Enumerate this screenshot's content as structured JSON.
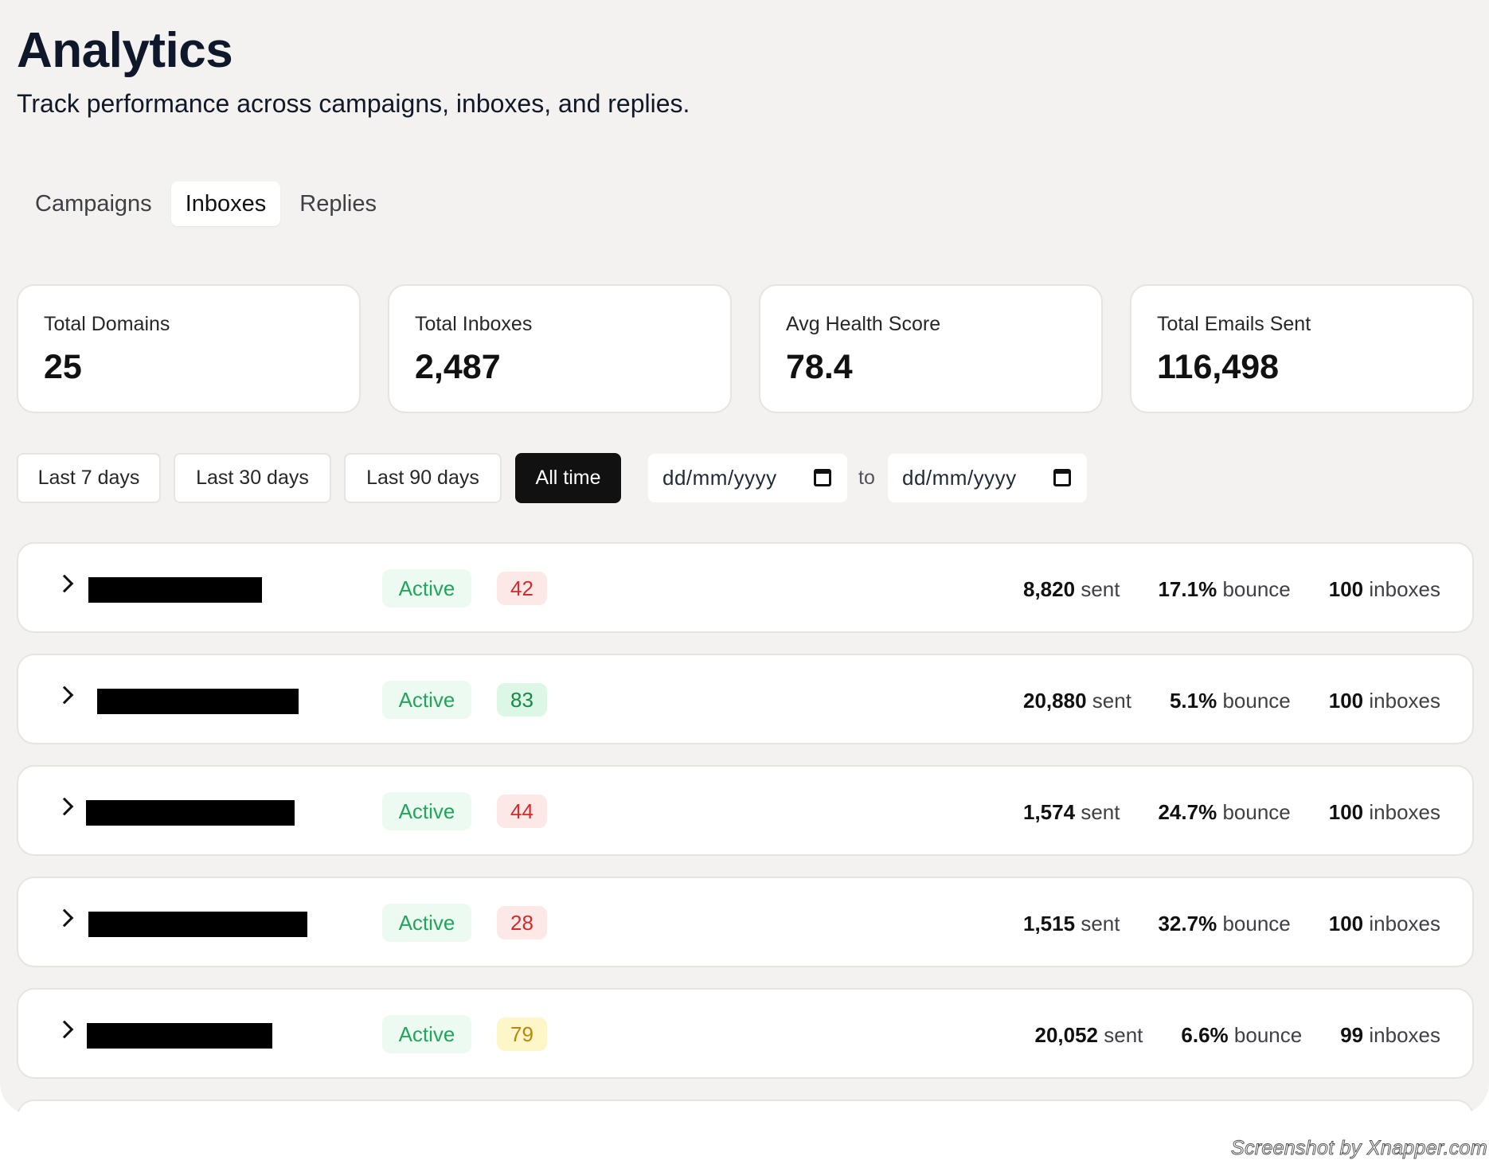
{
  "header": {
    "title": "Analytics",
    "subtitle": "Track performance across campaigns, inboxes, and replies."
  },
  "tabs": [
    {
      "label": "Campaigns",
      "active": false
    },
    {
      "label": "Inboxes",
      "active": true
    },
    {
      "label": "Replies",
      "active": false
    }
  ],
  "stats": [
    {
      "label": "Total Domains",
      "value": "25"
    },
    {
      "label": "Total Inboxes",
      "value": "2,487"
    },
    {
      "label": "Avg Health Score",
      "value": "78.4"
    },
    {
      "label": "Total Emails Sent",
      "value": "116,498"
    }
  ],
  "date_range": {
    "options": [
      "Last 7 days",
      "Last 30 days",
      "Last 90 days",
      "All time"
    ],
    "selected": "All time",
    "from_placeholder": "dd/mm/yyyy",
    "to_label": "to",
    "to_placeholder": "dd/mm/yyyy"
  },
  "domains": [
    {
      "status": "Active",
      "score": "42",
      "sent_value": "8,820",
      "sent_unit": "sent",
      "bounce_value": "17.1%",
      "bounce_unit": "bounce",
      "inbox_value": "100",
      "inbox_unit": "inboxes"
    },
    {
      "status": "Active",
      "score": "83",
      "sent_value": "20,880",
      "sent_unit": "sent",
      "bounce_value": "5.1%",
      "bounce_unit": "bounce",
      "inbox_value": "100",
      "inbox_unit": "inboxes"
    },
    {
      "status": "Active",
      "score": "44",
      "sent_value": "1,574",
      "sent_unit": "sent",
      "bounce_value": "24.7%",
      "bounce_unit": "bounce",
      "inbox_value": "100",
      "inbox_unit": "inboxes"
    },
    {
      "status": "Active",
      "score": "28",
      "sent_value": "1,515",
      "sent_unit": "sent",
      "bounce_value": "32.7%",
      "bounce_unit": "bounce",
      "inbox_value": "100",
      "inbox_unit": "inboxes"
    },
    {
      "status": "Active",
      "score": "79",
      "sent_value": "20,052",
      "sent_unit": "sent",
      "bounce_value": "6.6%",
      "bounce_unit": "bounce",
      "inbox_value": "99",
      "inbox_unit": "inboxes"
    }
  ],
  "colors": {
    "background": "#f3f2f0",
    "active_range": "#111111",
    "status_active": "#22a55a",
    "score_bad": "#d52b2b",
    "score_good": "#178a46",
    "score_mid": "#b8860b"
  },
  "watermark": "Screenshot by Xnapper.com"
}
